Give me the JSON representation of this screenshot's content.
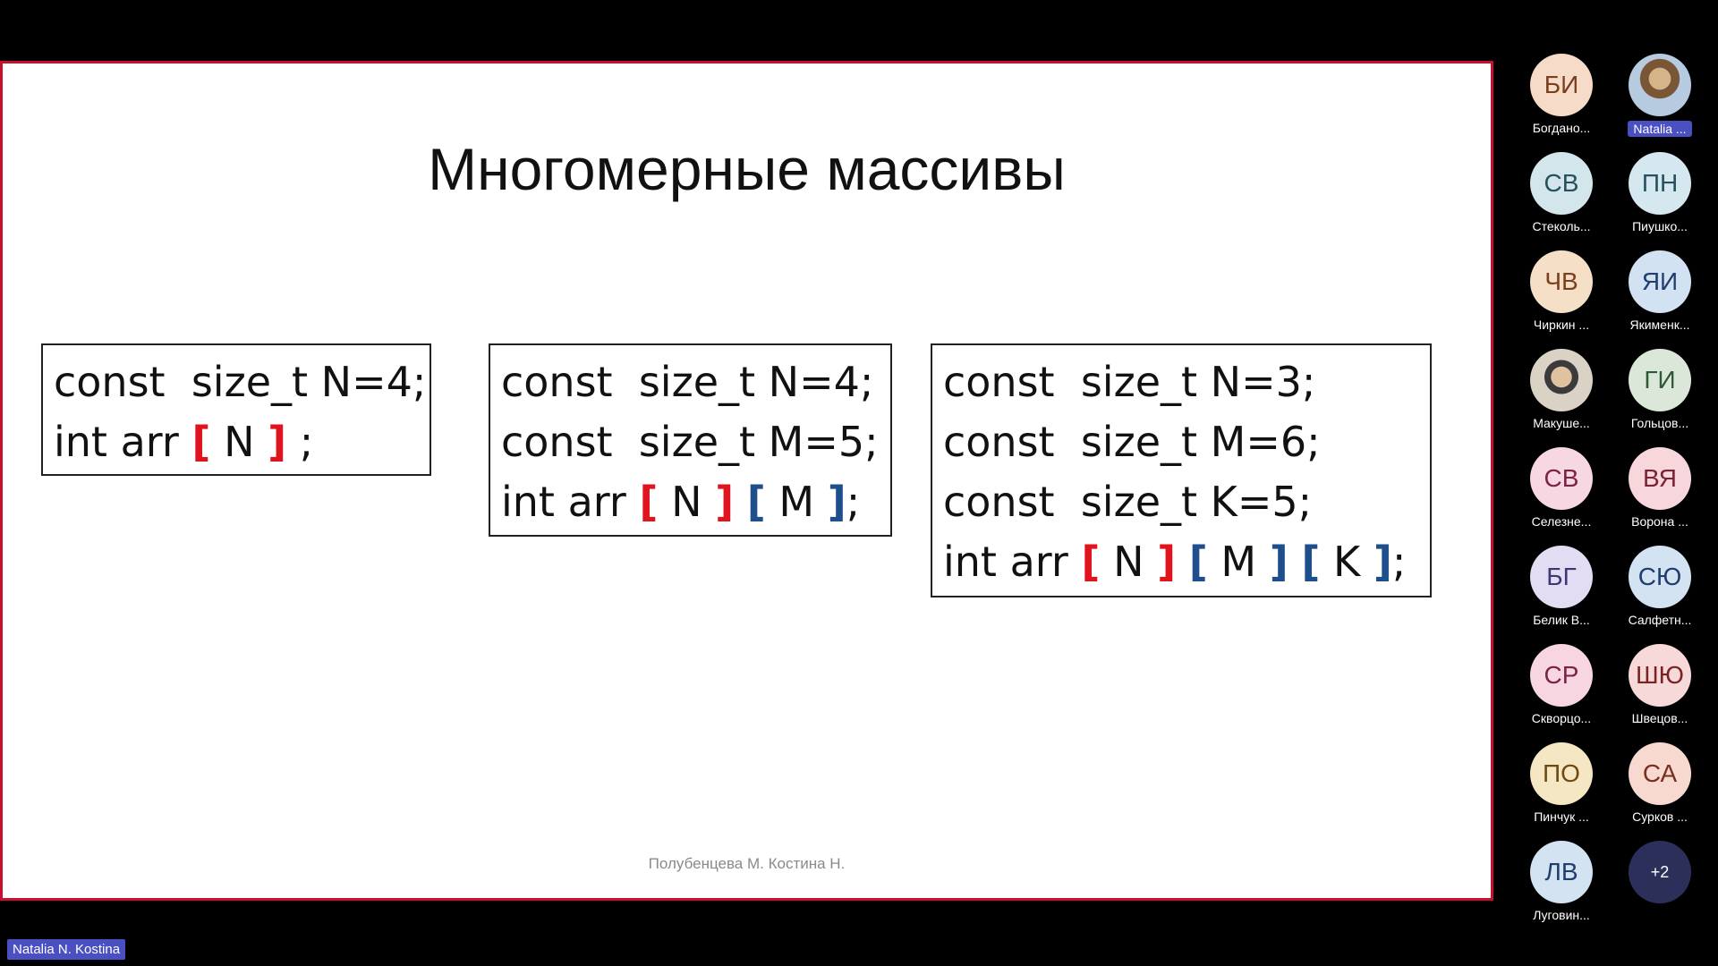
{
  "slide": {
    "title": "Многомерные массивы",
    "footer": "Полубенцева М. Костина Н.",
    "boxes": [
      {
        "lines": [
          "const  size_t N=4;"
        ],
        "decl_prefix": "int arr ",
        "dims": [
          [
            "[",
            " N ",
            "]"
          ]
        ],
        "end": " ;"
      },
      {
        "lines": [
          "const  size_t N=4;",
          "const  size_t M=5;"
        ],
        "decl_prefix": "int arr ",
        "dims": [
          [
            "[",
            " N ",
            "]"
          ],
          [
            "[",
            " M ",
            "]"
          ]
        ],
        "end": ";"
      },
      {
        "lines": [
          "const  size_t N=3;",
          "const  size_t M=6;",
          "const  size_t K=5;"
        ],
        "decl_prefix": "int arr ",
        "dims": [
          [
            "[",
            " N ",
            "]"
          ],
          [
            "[",
            " M ",
            "]"
          ],
          [
            "[",
            " K ",
            "]"
          ]
        ],
        "end": ";"
      }
    ]
  },
  "participants": [
    {
      "initials": "БИ",
      "name": "Богдано...",
      "bg": "#f6dcc8",
      "fg": "#7a3f1d"
    },
    {
      "initials": "",
      "name": "Natalia ...",
      "bg": "",
      "fg": "",
      "photo": true,
      "active": true
    },
    {
      "initials": "СВ",
      "name": "Стеколь...",
      "bg": "#d2e6ec",
      "fg": "#27505e"
    },
    {
      "initials": "ПН",
      "name": "Пиушко...",
      "bg": "#d5e7ef",
      "fg": "#27505e"
    },
    {
      "initials": "ЧВ",
      "name": "Чиркин ...",
      "bg": "#f5dfc6",
      "fg": "#7a3f1d"
    },
    {
      "initials": "ЯИ",
      "name": "Якименк...",
      "bg": "#d3e2f2",
      "fg": "#1f3d6e"
    },
    {
      "initials": "",
      "name": "Макуше...",
      "bg": "",
      "fg": "",
      "photo": true
    },
    {
      "initials": "ГИ",
      "name": "Гольцов...",
      "bg": "#dbe7d9",
      "fg": "#2f5a34"
    },
    {
      "initials": "СВ",
      "name": "Селезне...",
      "bg": "#f7d7e2",
      "fg": "#7a2346"
    },
    {
      "initials": "ВЯ",
      "name": "Ворона ...",
      "bg": "#f7d7dc",
      "fg": "#7a2336"
    },
    {
      "initials": "БГ",
      "name": "Белик В...",
      "bg": "#e2ddf2",
      "fg": "#3e3675"
    },
    {
      "initials": "СЮ",
      "name": "Салфетн...",
      "bg": "#d3e3f2",
      "fg": "#1f3d6e"
    },
    {
      "initials": "СР",
      "name": "Скворцо...",
      "bg": "#f7d6e2",
      "fg": "#7a2346"
    },
    {
      "initials": "ШЮ",
      "name": "Швецов...",
      "bg": "#f7d9d9",
      "fg": "#7a2323"
    },
    {
      "initials": "ПО",
      "name": "Пинчук ...",
      "bg": "#f6e7c4",
      "fg": "#6e4a10"
    },
    {
      "initials": "СА",
      "name": "Сурков ...",
      "bg": "#f8d9d0",
      "fg": "#7a2e1d"
    },
    {
      "initials": "ЛВ",
      "name": "Луговин...",
      "bg": "#d3e3f2",
      "fg": "#1f3d6e"
    },
    {
      "initials": "+2",
      "name": "",
      "more": true
    }
  ],
  "name_tag": "Natalia N. Kostina"
}
